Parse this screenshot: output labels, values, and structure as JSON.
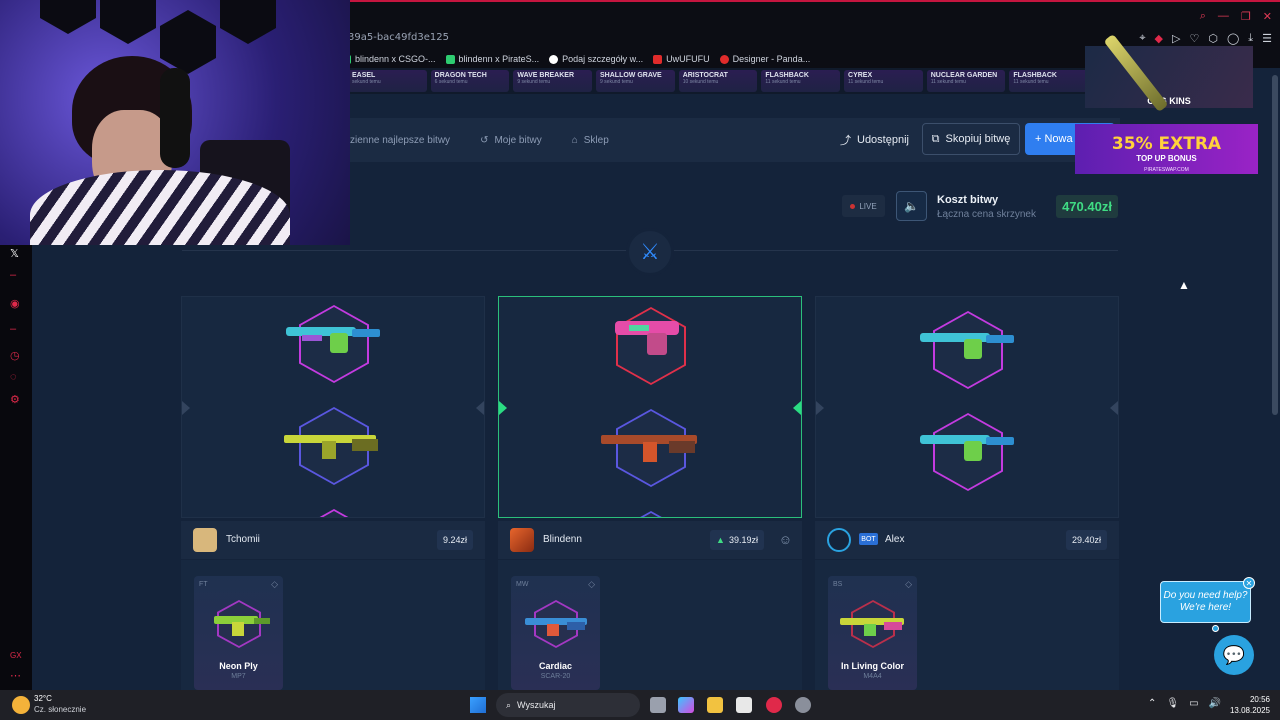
{
  "browser": {
    "url_fragment": "39a5-bac49fd3e125",
    "bookmarks": [
      "blindenn x CSGO-...",
      "blindenn x PirateS...",
      "Podaj szczegóły w...",
      "UwUFUFU",
      "Designer - Panda..."
    ],
    "bookmark_colors": [
      "#2ecc71",
      "#2ecc71",
      "#ffffff",
      "#e02b2b",
      "#e02b2b"
    ]
  },
  "ribbon_cases": [
    {
      "name": "EASEL",
      "sub": "sekund temu"
    },
    {
      "name": "DRAGON TECH",
      "sub": "6 sekund temu"
    },
    {
      "name": "WAVE BREAKER",
      "sub": "9 sekund temu"
    },
    {
      "name": "SHALLOW GRAVE",
      "sub": "9 sekund temu"
    },
    {
      "name": "ARISTOCRAT",
      "sub": "10 sekund temu"
    },
    {
      "name": "FLASHBACK",
      "sub": "11 sekund temu"
    },
    {
      "name": "CYREX",
      "sub": "11 sekund temu"
    },
    {
      "name": "NUCLEAR GARDEN",
      "sub": "11 sekund temu"
    },
    {
      "name": "FLASHBACK",
      "sub": "11 sekund temu"
    }
  ],
  "nav": {
    "links": [
      "zienne najlepsze bitwy",
      "Moje bitwy",
      "Sklep"
    ],
    "share": "Udostępnij",
    "copy": "Skopiuj bitwę",
    "new": "+ Nowa"
  },
  "ads": {
    "skins_label": "CSG   KINS",
    "pirate_main": "35% EXTRA",
    "pirate_sub": "TOP UP BONUS",
    "pirate_site": "PIRATESWAP.COM"
  },
  "battle": {
    "live": "LIVE",
    "cost_title": "Koszt bitwy",
    "cost_sub": "Łączna cena skrzynek",
    "cost_value": "470.40zł"
  },
  "players": [
    {
      "name": "Tchomii",
      "value": "9.24zł",
      "bot": false,
      "item": {
        "condition": "FT",
        "skin": "Neon Ply",
        "weapon": "MP7"
      }
    },
    {
      "name": "Blindenn",
      "value": "39.19zł",
      "bot": false,
      "item": {
        "condition": "MW",
        "skin": "Cardiac",
        "weapon": "SCAR-20"
      }
    },
    {
      "name": "Alex",
      "value": "29.40zł",
      "bot": true,
      "bot_label": "BOT",
      "item": {
        "condition": "BS",
        "skin": "In Living Color",
        "weapon": "M4A4"
      }
    }
  ],
  "chat": {
    "line1": "Do you need help?",
    "line2": "We're here!"
  },
  "taskbar": {
    "temp": "32°C",
    "weather": "Cz. słonecznie",
    "search": "Wyszukaj",
    "time": "20:56",
    "date": "13.08.2025"
  },
  "colors": {
    "accent": "#2f7ef0",
    "green": "#3fdc84",
    "purple_ring": "#c33be0",
    "blue_ring": "#5a57e0",
    "red_ring": "#e0304a"
  }
}
